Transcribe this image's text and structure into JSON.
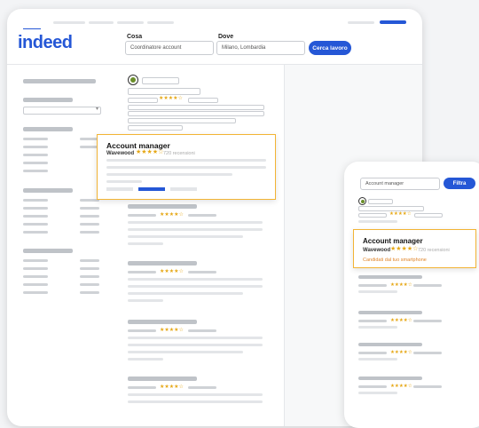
{
  "brand": {
    "logo": "indeed",
    "color": "#2557d6"
  },
  "search": {
    "what_label": "Cosa",
    "what_value": "Coordinatore account",
    "where_label": "Dove",
    "where_value": "Milano, Lombardia",
    "button": "Cerca lavoro"
  },
  "featured_job": {
    "title": "Account manager",
    "company": "Wavewood",
    "rating": "★★★★☆",
    "reviews": "720 recensioni"
  },
  "mobile": {
    "search_value": "Account manager",
    "filter_button": "Filtra",
    "job_title": "Account manager",
    "company": "Wavewood",
    "rating": "★★★★☆",
    "reviews": "720 recensioni",
    "apply_link": "Candidati dal tuo smartphone"
  },
  "star_rating": "★★★★☆",
  "colors": {
    "accent": "#2557d6",
    "highlight_border": "#f2b435",
    "star": "#e6a817"
  }
}
